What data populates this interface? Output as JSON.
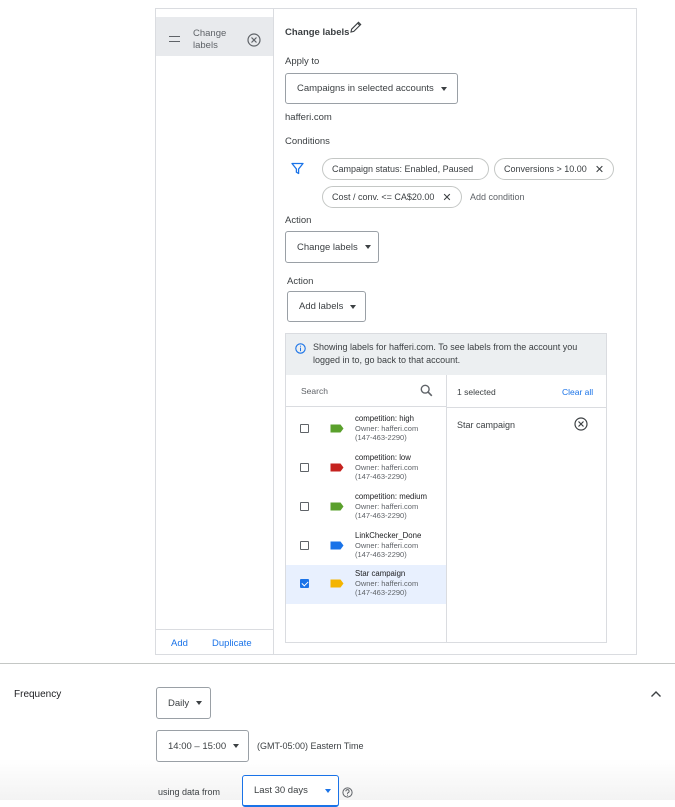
{
  "rule_list": {
    "item_label_line1": "Change",
    "item_label_line2": "labels",
    "add_label": "Add",
    "duplicate_label": "Duplicate"
  },
  "rule": {
    "title": "Change labels",
    "apply_to_label": "Apply to",
    "apply_to_value": "Campaigns in selected accounts",
    "account": "hafferi.com",
    "conditions_label": "Conditions",
    "conditions": [
      "Campaign status: Enabled, Paused",
      "Conversions > 10.00",
      "Cost / conv. <= CA$20.00"
    ],
    "add_condition": "Add condition",
    "action_label": "Action",
    "action_value": "Change labels",
    "sub_action_label": "Action",
    "sub_action_value": "Add labels"
  },
  "label_picker": {
    "info_line1": "Showing labels for hafferi.com. To see labels from the account you",
    "info_line2": "logged in to, go back to that account.",
    "search_placeholder": "Search",
    "selected_count": "1 selected",
    "clear_all": "Clear all",
    "labels": [
      {
        "name": "competition: high",
        "owner": "Owner: hafferi.com",
        "cid": "(147-463-2290)",
        "color": "#5aa02c",
        "checked": false
      },
      {
        "name": "competition: low",
        "owner": "Owner: hafferi.com",
        "cid": "(147-463-2290)",
        "color": "#c5221f",
        "checked": false
      },
      {
        "name": "competition: medium",
        "owner": "Owner: hafferi.com",
        "cid": "(147-463-2290)",
        "color": "#5aa02c",
        "checked": false
      },
      {
        "name": "LinkChecker_Done",
        "owner": "Owner: hafferi.com",
        "cid": "(147-463-2290)",
        "color": "#1a73e8",
        "checked": false
      },
      {
        "name": "Star campaign",
        "owner": "Owner: hafferi.com",
        "cid": "(147-463-2290)",
        "color": "#f4b400",
        "checked": true
      }
    ],
    "selected": [
      "Star campaign"
    ]
  },
  "frequency": {
    "title": "Frequency",
    "period": "Daily",
    "time_range": "14:00 – 15:00",
    "timezone": "(GMT-05:00) Eastern Time",
    "data_prefix": "using data from",
    "data_range": "Last 30 days"
  },
  "colors": {
    "accent": "#1a73e8",
    "selected_row": "#e8f0fe"
  }
}
